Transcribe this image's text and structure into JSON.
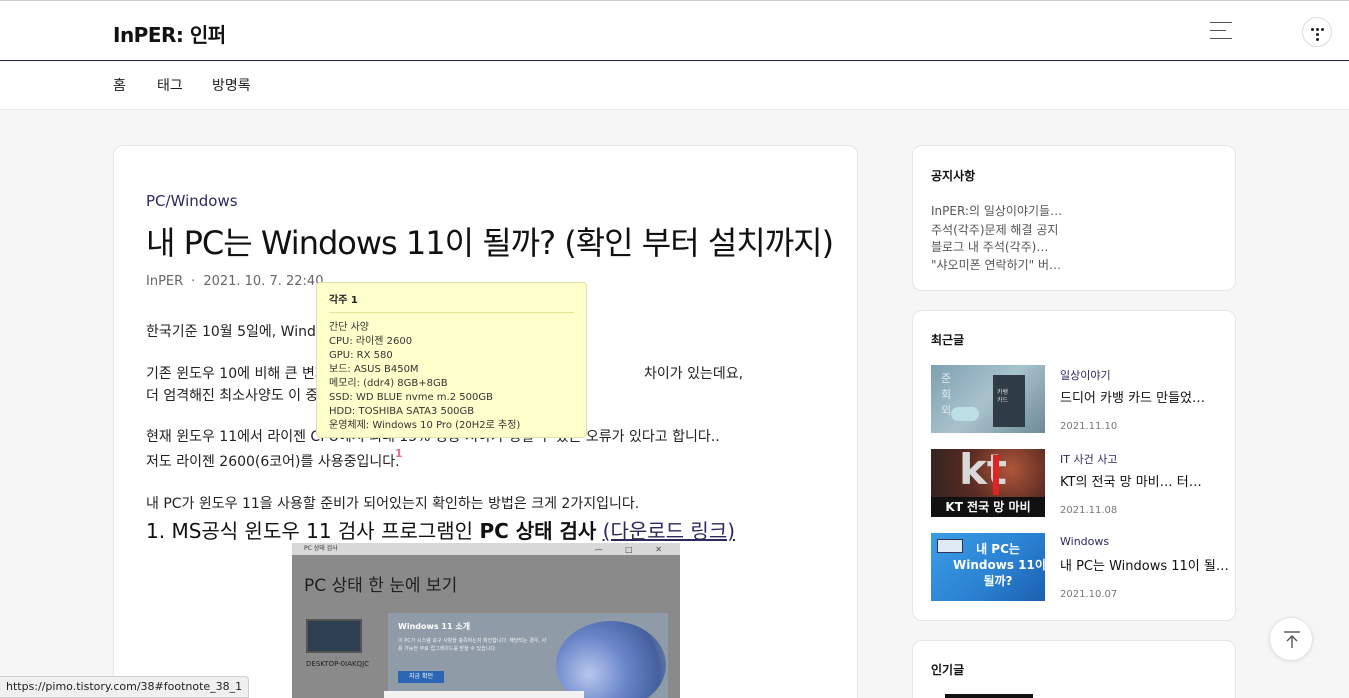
{
  "site": {
    "title": "InPER: 인퍼"
  },
  "nav": {
    "items": [
      "홈",
      "태그",
      "방명록"
    ]
  },
  "post": {
    "category": "PC/Windows",
    "title": "내 PC는 Windows 11이 될까? (확인 부터 설치까지)",
    "author": "InPER",
    "date": "2021. 10. 7. 22:40",
    "lines": [
      "한국기준 10월 5일에, Windo",
      "기존 윈도우 10에 비해 큰 변화",
      "차이가 있는데요,",
      "더 엄격해진 최소사양도 이 중",
      "현재 윈도우 11에서 라이젠 CPU에서 최대 15% 성능 저하가 생길 수 있는 오류가 있다고 합니다..",
      "저도 라이젠 2600(6코어)를 사용중입니다.",
      "내 PC가 윈도우 11을 사용할 준비가 되어있는지 확인하는 방법은 크게 2가지입니다."
    ],
    "footnote_ref": "1",
    "section_heading": {
      "prefix": "1. MS공식 윈도우 11 검사 프로그램인 ",
      "bold": "PC 상태 검사",
      "link": "(다운로드 링크)"
    },
    "screenshot": {
      "window_title": "PC 상태 검사",
      "window_controls": "— □ ✕",
      "heading": "PC 상태 한 눈에 보기",
      "device_name": "DESKTOP-0IAKQJC",
      "panel_title": "Windows 11 소개",
      "panel_text": "이 PC가 시스템 요구 사항을 충족하는지 확인합니다. 해당되는 경우, 사용 가능한 무료 업그레이드를 받을 수 있습니다.",
      "panel_button": "지금 확인"
    }
  },
  "tooltip": {
    "title": "각주 1",
    "lines": [
      "간단 사양",
      "CPU: 라이젠 2600",
      "GPU: RX 580",
      "보드: ASUS B450M",
      "메모리: (ddr4) 8GB+8GB",
      "SSD: WD BLUE nvme m.2 500GB",
      "HDD: TOSHIBA SATA3 500GB",
      "운영체제: Windows 10 Pro (20H2로 추정)"
    ]
  },
  "sidebar": {
    "notice": {
      "title": "공지사항",
      "items": [
        "InPER:의 일상이야기들…",
        "주석(각주)문제 해결 공지",
        "블로그 내 주석(각주)…",
        "\"샤오미폰 연락하기\" 버…"
      ]
    },
    "recent": {
      "title": "최근글",
      "items": [
        {
          "category": "일상이야기",
          "title": "드디어 카뱅 카드 만들었…",
          "date": "2021.11.10",
          "thumb_text": "준\n회\n외",
          "thumb_card": "카뱅\n카드"
        },
        {
          "category": "IT 사건 사고",
          "title": "KT의 전국 망 마비… 터…",
          "date": "2021.11.08",
          "thumb_logo": "kt",
          "thumb_caption": "KT 전국 망 마비"
        },
        {
          "category": "Windows",
          "title": "내 PC는 Windows 11이 될…",
          "date": "2021.10.07",
          "thumb_text": "내 PC는\nWindows 11이\n될까?"
        }
      ]
    },
    "popular": {
      "title": "인기글"
    }
  },
  "status_bar": {
    "url": "https://pimo.tistory.com/38#footnote_38_1"
  },
  "colors": {
    "accent": "#2c2a5c",
    "footnote": "#e56d8e",
    "tooltip_bg": "#ffffcc",
    "page_bg": "#f6f6f6"
  },
  "icons": {
    "menu": "hamburger-icon",
    "profile": "profile-dots-icon",
    "top": "arrow-up-icon"
  }
}
